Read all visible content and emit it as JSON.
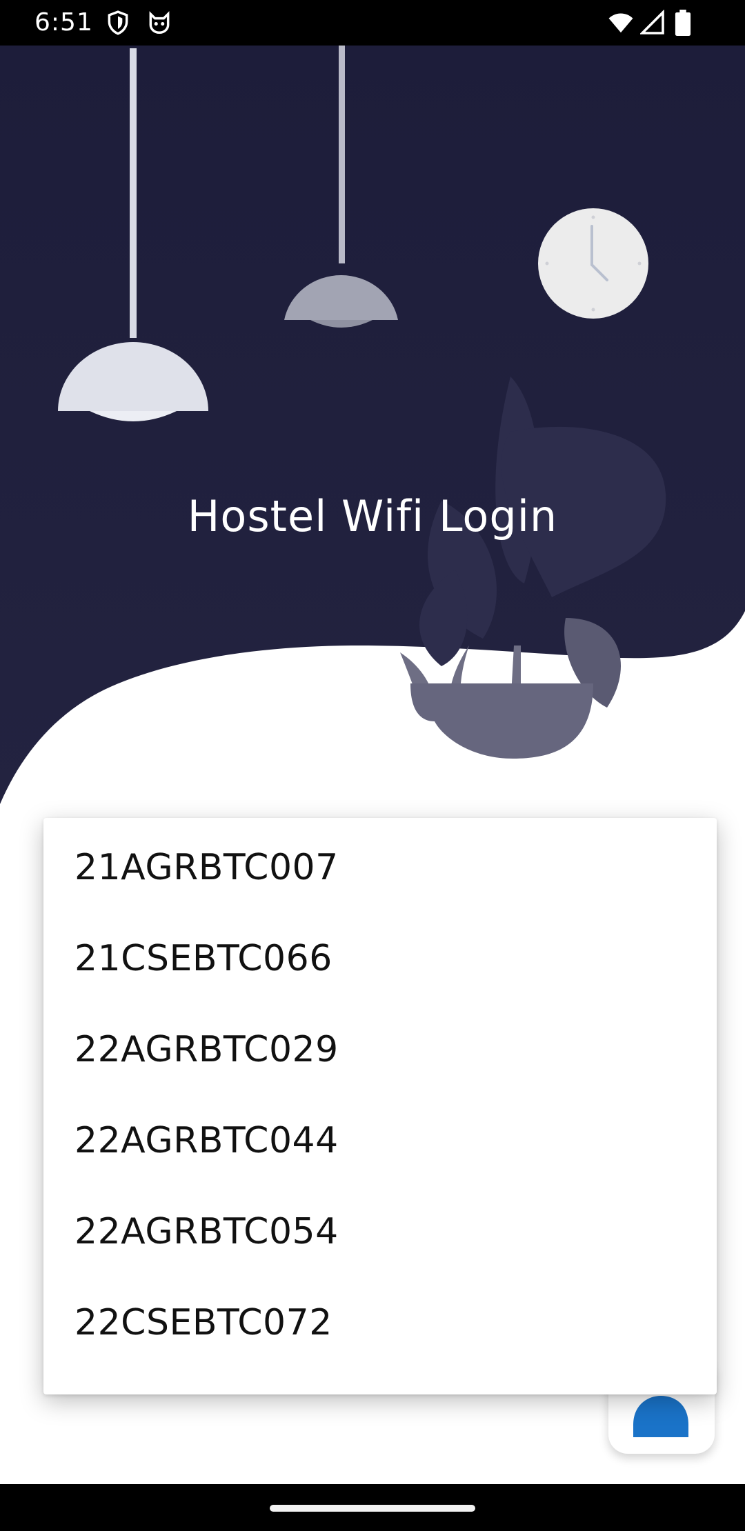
{
  "status_bar": {
    "time": "6:51",
    "left_icons": [
      "shield-icon",
      "cat-face-icon"
    ],
    "right_icons": [
      "wifi-icon",
      "signal-icon",
      "battery-icon"
    ]
  },
  "app": {
    "title": "Hostel Wifi Login",
    "colors": {
      "header": "#1f1f3b",
      "accent": "#1a73c8"
    }
  },
  "dropdown": {
    "options": [
      "21AGRBTC007",
      "21CSEBTC066",
      "22AGRBTC029",
      "22AGRBTC044",
      "22AGRBTC054",
      "22CSEBTC072"
    ]
  },
  "fab": {
    "icon": "add-user-icon"
  }
}
